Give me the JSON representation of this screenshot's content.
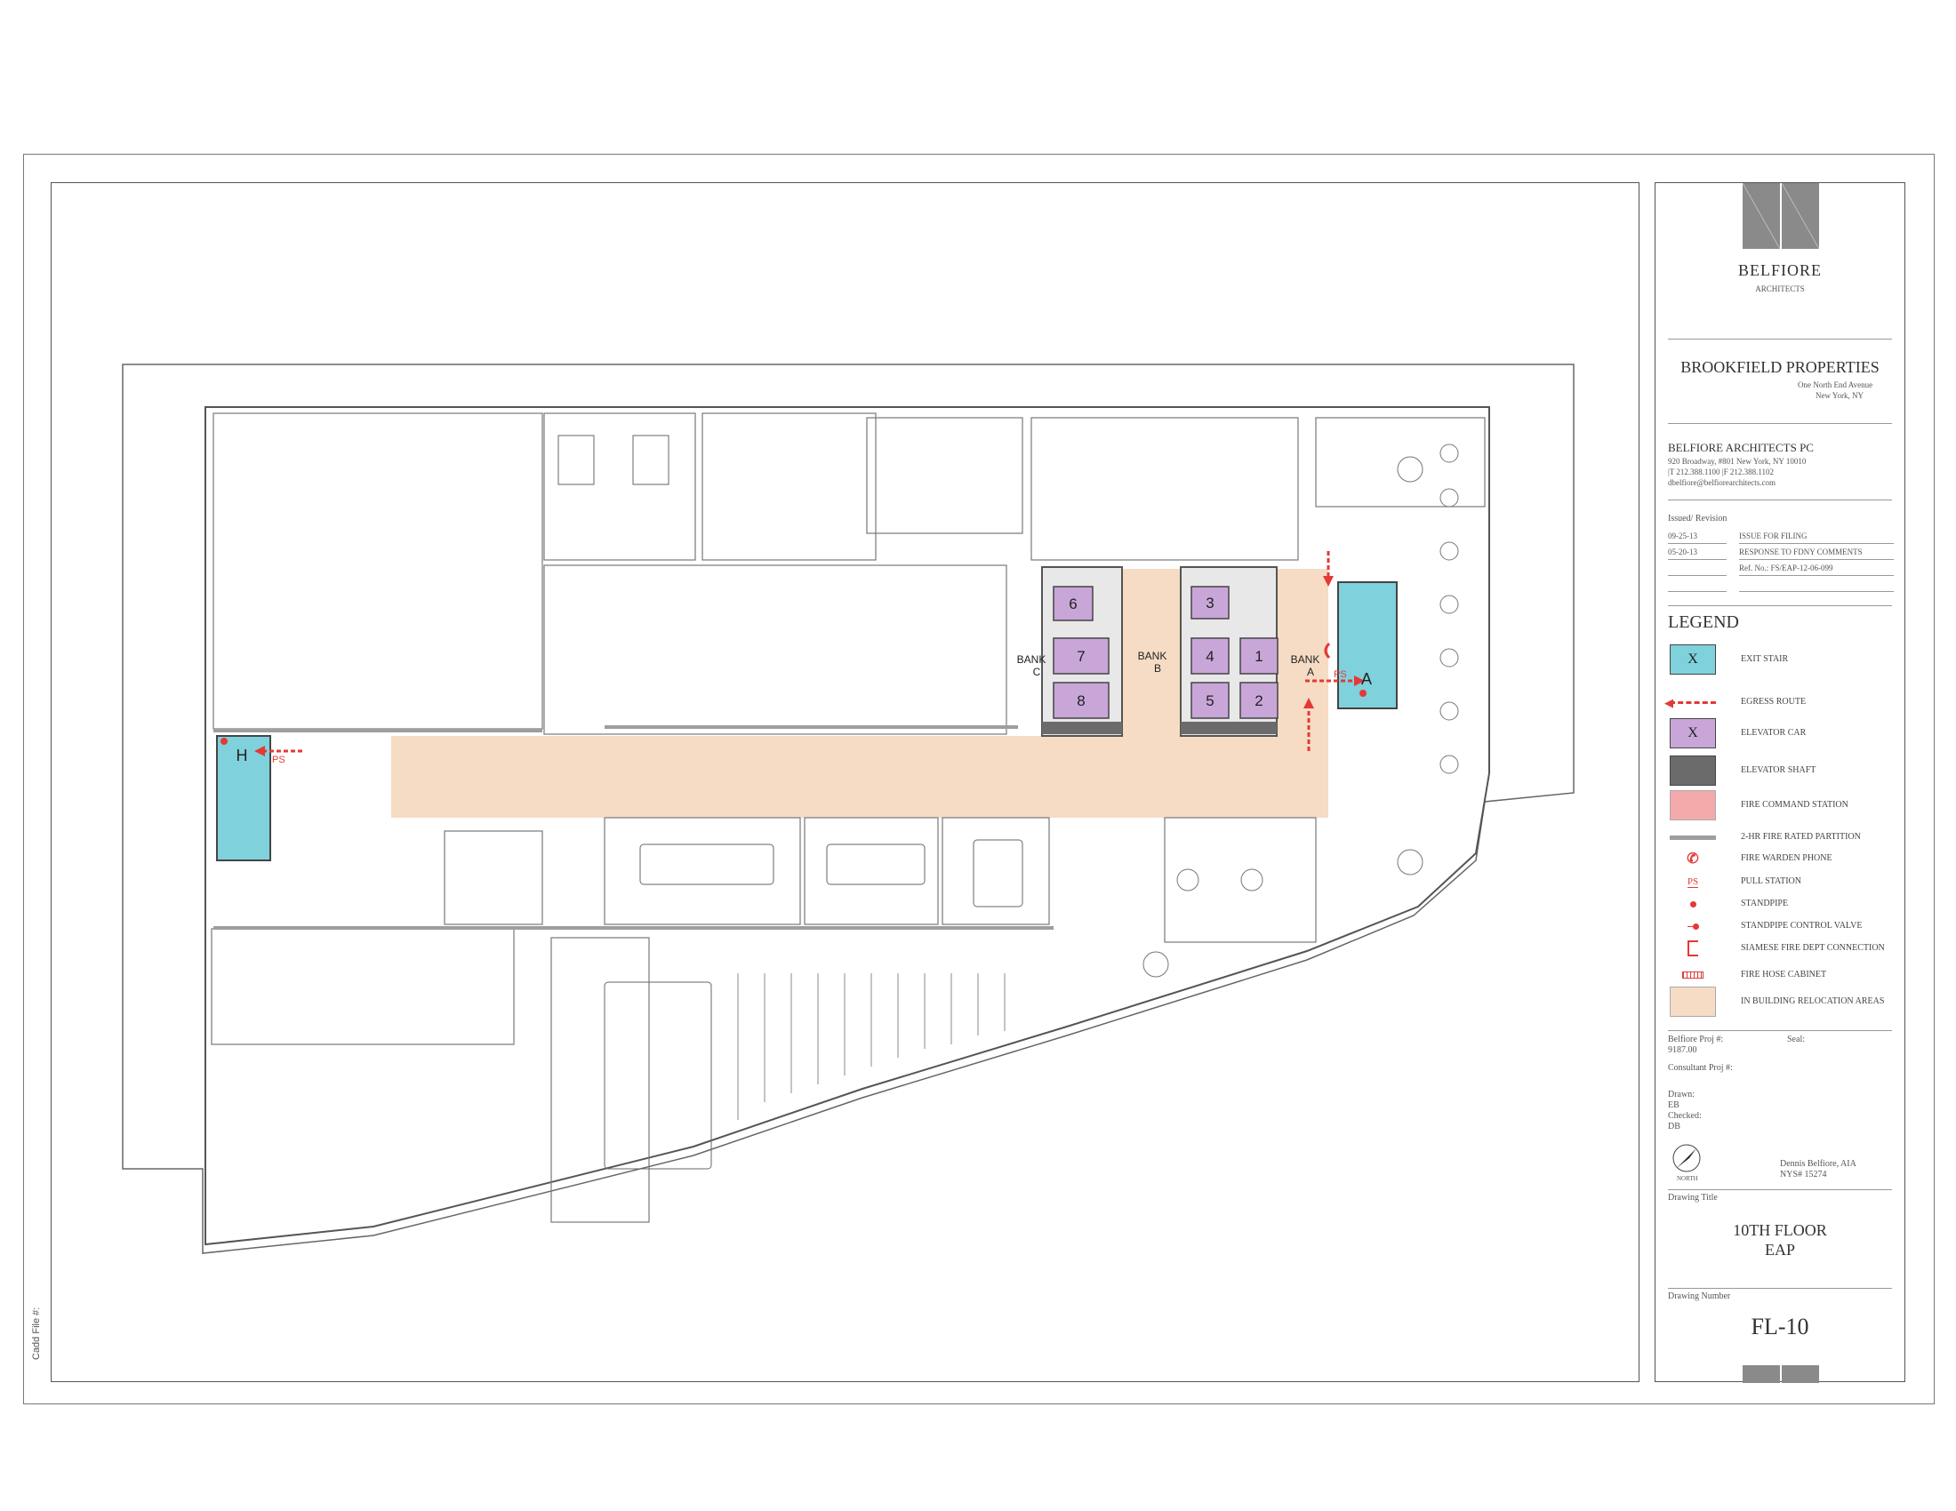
{
  "sheet": {
    "cadd_file_label": "Cadd File #:"
  },
  "plan": {
    "bank_labels": [
      {
        "top": "BANK",
        "bottom": "C"
      },
      {
        "top": "BANK",
        "bottom": "B"
      },
      {
        "top": "BANK",
        "bottom": "A"
      }
    ],
    "elevator_cars": [
      "6",
      "3",
      "7",
      "4",
      "1",
      "8",
      "5",
      "2"
    ],
    "stair_labels": [
      "A",
      "H"
    ],
    "pull_station_mark": "PS"
  },
  "titleblock": {
    "firm_name": "BELFIORE",
    "firm_sub": "ARCHITECTS",
    "client_name": "BROOKFIELD PROPERTIES",
    "client_address_1": "One North End Avenue",
    "client_address_2": "New York, NY",
    "architect_name": "BELFIORE ARCHITECTS PC",
    "architect_address": "920 Broadway, #801   New York, NY 10010",
    "architect_phone": "|T  212.388.1100   |F  212.388.1102",
    "architect_email": "dbelfiore@belfiorearchitects.com",
    "issued_label": "Issued/ Revision",
    "revisions": [
      {
        "date": "09-25-13",
        "desc": "ISSUE FOR FILING"
      },
      {
        "date": "05-20-13",
        "desc": "RESPONSE TO FDNY COMMENTS"
      }
    ],
    "ref_no": "Ref. No.: FS/EAP-12-06-099",
    "legend_title": "LEGEND",
    "legend_items": [
      {
        "symbol": "exit-stair",
        "mark": "X",
        "label": "EXIT STAIR",
        "color": "#7fd1dc"
      },
      {
        "symbol": "egress-route",
        "label": "EGRESS ROUTE",
        "color": "#e53935"
      },
      {
        "symbol": "elevator-car",
        "mark": "X",
        "label": "ELEVATOR CAR",
        "color": "#c9a6d8"
      },
      {
        "symbol": "elevator-shaft",
        "label": "ELEVATOR SHAFT",
        "color": "#6b6b6b"
      },
      {
        "symbol": "fire-command-station",
        "label": "FIRE COMMAND STATION",
        "color": "#f4a9ab"
      },
      {
        "symbol": "fire-rated-partition",
        "label": "2-HR FIRE RATED PARTITION",
        "color": "#9e9e9e"
      },
      {
        "symbol": "fire-warden-phone",
        "label": "FIRE WARDEN PHONE",
        "color": "#e53935"
      },
      {
        "symbol": "pull-station",
        "mark": "PS",
        "label": "PULL STATION",
        "color": "#e53935"
      },
      {
        "symbol": "standpipe",
        "label": "STANDPIPE",
        "color": "#e53935"
      },
      {
        "symbol": "standpipe-control-valve",
        "label": "STANDPIPE CONTROL VALVE",
        "color": "#e53935"
      },
      {
        "symbol": "siamese-connection",
        "label": "SIAMESE FIRE DEPT CONNECTION",
        "color": "#e53935"
      },
      {
        "symbol": "fire-hose-cabinet",
        "label": "FIRE HOSE CABINET",
        "color": "#e53935"
      },
      {
        "symbol": "relocation-area",
        "label": "IN BUILDING RELOCATION AREAS",
        "color": "#f6dcc4"
      }
    ],
    "belfiore_proj_label": "Belfiore Proj #:",
    "belfiore_proj_value": "9187.00",
    "seal_label": "Seal:",
    "consultant_proj_label": "Consultant Proj #:",
    "drawn_label": "Drawn:",
    "drawn_value": "EB",
    "checked_label": "Checked:",
    "checked_value": "DB",
    "north_label": "NORTH",
    "signer_name": "Dennis Belfiore, AIA",
    "signer_license": "NYS# 15274",
    "drawing_title_label": "Drawing Title",
    "drawing_title_1": "10TH FLOOR",
    "drawing_title_2": "EAP",
    "drawing_number_label": "Drawing Number",
    "drawing_number": "FL-10"
  }
}
